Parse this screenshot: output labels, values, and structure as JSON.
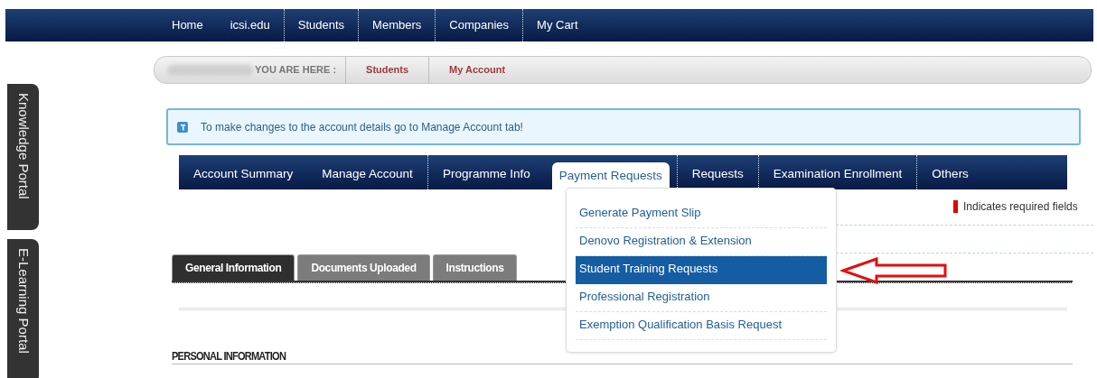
{
  "top_nav": {
    "items": [
      {
        "label": "Home"
      },
      {
        "label": "icsi.edu"
      },
      {
        "label": "Students"
      },
      {
        "label": "Members"
      },
      {
        "label": "Companies"
      },
      {
        "label": "My Cart"
      }
    ]
  },
  "breadcrumb": {
    "prefix": "YOU ARE HERE :",
    "items": [
      "Students",
      "My Account"
    ]
  },
  "notice": {
    "text": "To make changes to the account details go to Manage Account tab!"
  },
  "account_tabs": [
    {
      "label": "Account Summary",
      "selected": false
    },
    {
      "label": "Manage Account",
      "selected": false
    },
    {
      "label": "Programme Info",
      "selected": false
    },
    {
      "label": "Payment Requests",
      "selected": true
    },
    {
      "label": "Requests",
      "selected": false
    },
    {
      "label": "Examination Enrollment",
      "selected": false
    },
    {
      "label": "Others",
      "selected": false
    }
  ],
  "dropdown": {
    "items": [
      {
        "label": "Generate Payment Slip",
        "selected": false
      },
      {
        "label": "Denovo Registration & Extension",
        "selected": false
      },
      {
        "label": "Student Training Requests",
        "selected": true
      },
      {
        "label": "Professional Registration",
        "selected": false
      },
      {
        "label": "Exemption Qualification Basis Request",
        "selected": false
      }
    ]
  },
  "required_note": "Indicates required fields",
  "content_tabs": [
    {
      "label": "General Information",
      "selected": true
    },
    {
      "label": "Documents Uploaded",
      "selected": false
    },
    {
      "label": "Instructions",
      "selected": false
    }
  ],
  "section_heading": "PERSONAL INFORMATION",
  "side_tabs": [
    "Knowledge Portal",
    "E-Learning Portal"
  ]
}
